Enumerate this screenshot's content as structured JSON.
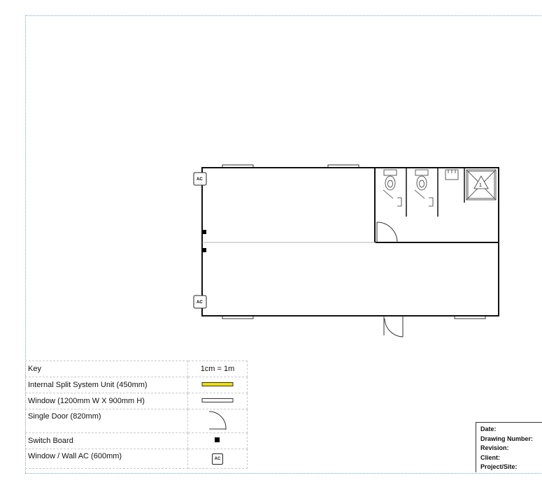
{
  "plan": {
    "ac_label": "AC",
    "shower_number": "1"
  },
  "key": {
    "header_label": "Key",
    "header_scale": "1cm = 1m",
    "items": [
      {
        "label": "Internal Split System Unit (450mm)",
        "symbol": "split-unit"
      },
      {
        "label": "Window (1200mm W X 900mm H)",
        "symbol": "window"
      },
      {
        "label": "Single Door (820mm)",
        "symbol": "door"
      },
      {
        "label": "Switch Board",
        "symbol": "switch-board"
      },
      {
        "label": "Window / Wall AC (600mm)",
        "symbol": "wall-ac"
      }
    ],
    "split_color": "#f0e000"
  },
  "title_block": {
    "date_label": "Date:",
    "drawing_number_label": "Drawing Number:",
    "revision_label": "Revision:",
    "client_label": "Client:",
    "project_site_label": "Project/Site:"
  }
}
